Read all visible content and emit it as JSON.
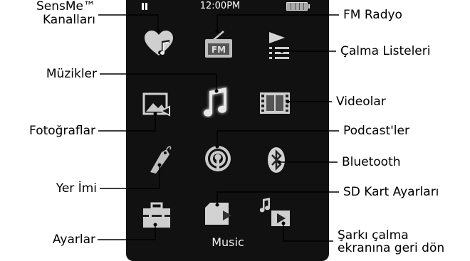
{
  "status": {
    "time": "12:00PM"
  },
  "screen": {
    "music_label": "Music"
  },
  "callouts": {
    "sensme": "SensMe™\nKanalları",
    "fm_radio": "FM Radyo",
    "playlists": "Çalma Listeleri",
    "music": "Müzikler",
    "videos": "Videolar",
    "photos": "Fotoğraflar",
    "podcasts": "Podcast'ler",
    "bookmark": "Yer İmi",
    "bluetooth": "Bluetooth",
    "sd_settings": "SD Kart Ayarları",
    "settings": "Ayarlar",
    "now_playing": "Şarkı çalma\nekranına geri dön"
  },
  "icons": [
    "sensme-heart-icon",
    "fm-radio-icon",
    "playlist-icon",
    "photo-icon",
    "music-note-icon",
    "film-icon",
    "bookmark-tag-icon",
    "podcast-icon",
    "bluetooth-icon",
    "toolbox-icon",
    "sd-card-icon",
    "now-playing-icon"
  ],
  "colors": {
    "screen_bg": "#111111",
    "icon_fill": "#d9d9d9",
    "music_glow": "#ffffff"
  }
}
